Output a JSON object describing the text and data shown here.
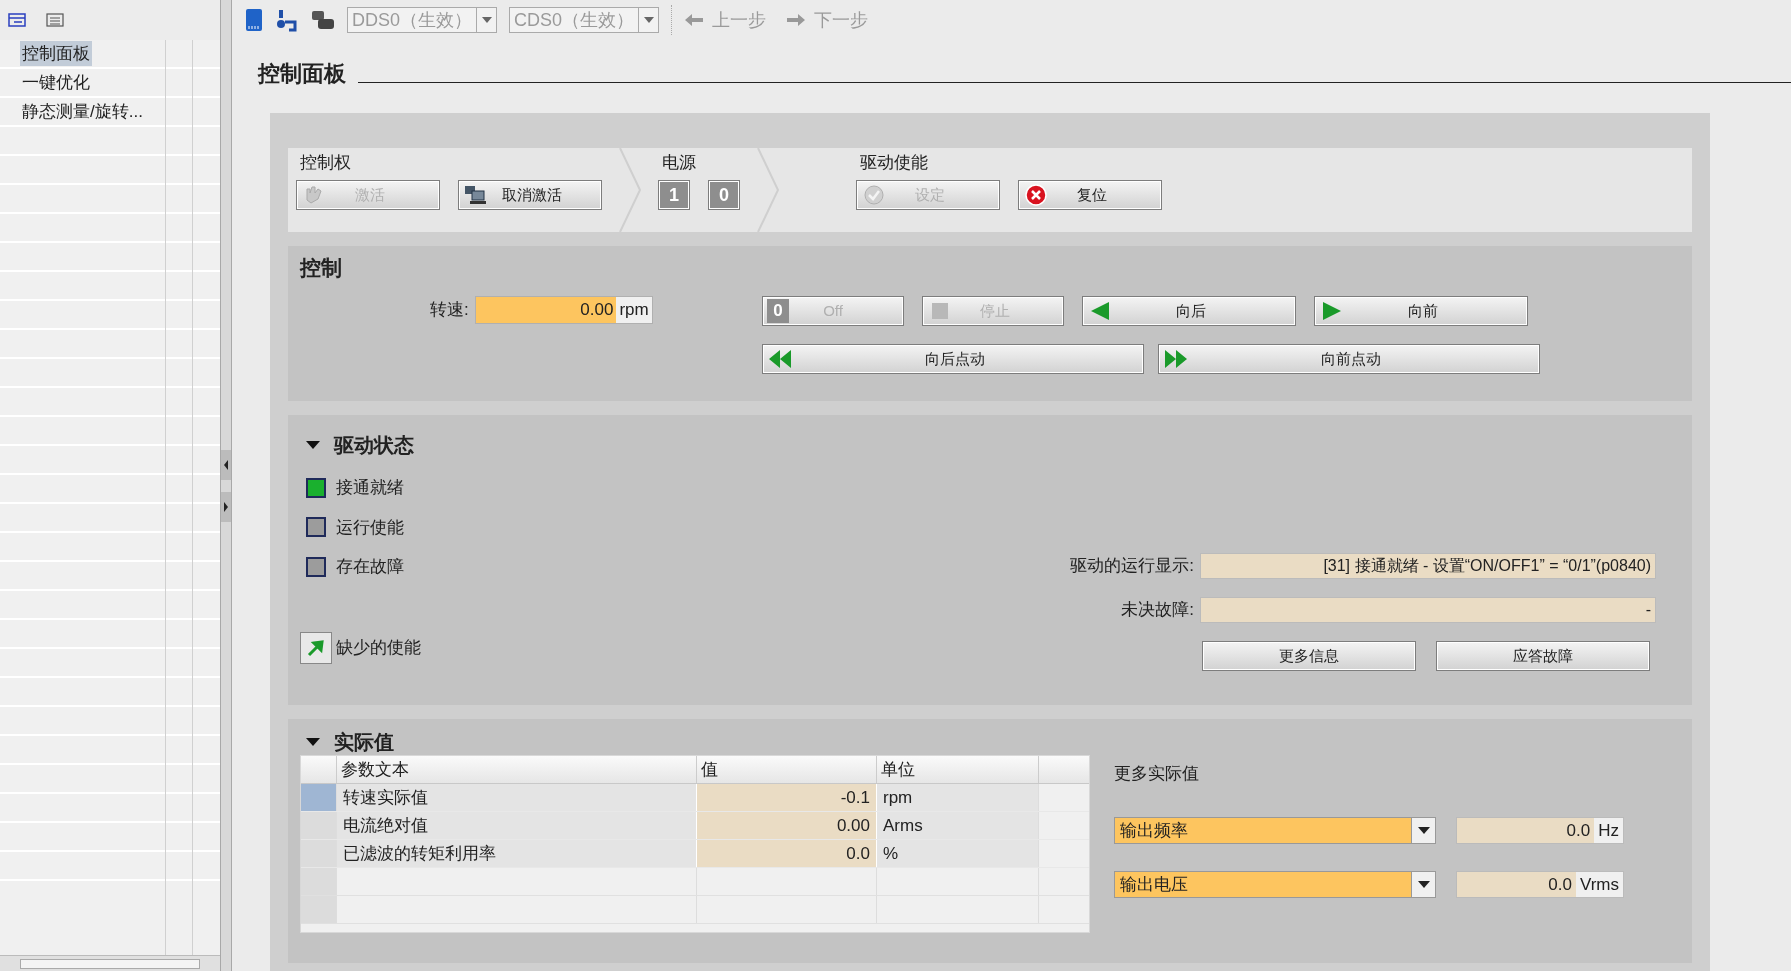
{
  "sidebar": {
    "items": [
      {
        "label": "控制面板",
        "selected": true
      },
      {
        "label": "一键优化",
        "selected": false
      },
      {
        "label": "静态测量/旋转...",
        "selected": false
      }
    ]
  },
  "toolbar": {
    "dds": "DDS0（生效）",
    "cds": "CDS0（生效）",
    "back": "上一步",
    "forward": "下一步"
  },
  "page_title": "控制面板",
  "top_strip": [
    {
      "label": "控制权",
      "buttons": [
        {
          "kind": "hand",
          "label": "激活",
          "disabled": true
        },
        {
          "kind": "pc",
          "label": "取消激活",
          "disabled": false
        }
      ]
    },
    {
      "label": "电源",
      "buttons": [
        {
          "kind": "square",
          "label": "1",
          "disabled": true
        },
        {
          "kind": "square",
          "label": "0",
          "disabled": true
        }
      ]
    },
    {
      "label": "驱动使能",
      "buttons": [
        {
          "kind": "check",
          "label": "设定",
          "disabled": true
        },
        {
          "kind": "error",
          "label": "复位",
          "disabled": false
        }
      ]
    }
  ],
  "control": {
    "title": "控制",
    "speed_label": "转速:",
    "speed_value": "0.00",
    "speed_unit": "rpm",
    "buttons": [
      {
        "kind": "off",
        "icon_text": "0",
        "label": "Off",
        "disabled": true
      },
      {
        "kind": "stop",
        "label": "停止",
        "disabled": true
      },
      {
        "kind": "back",
        "label": "向后",
        "disabled": false
      },
      {
        "kind": "forward",
        "label": "向前",
        "disabled": false
      },
      {
        "kind": "jog_back",
        "label": "向后点动",
        "disabled": false
      },
      {
        "kind": "jog_forward",
        "label": "向前点动",
        "disabled": false
      }
    ]
  },
  "drive_status": {
    "title": "驱动状态",
    "expanded": true,
    "indicators": [
      {
        "label": "接通就绪",
        "on": true
      },
      {
        "label": "运行使能",
        "on": false
      },
      {
        "label": "存在故障",
        "on": false
      }
    ],
    "missing_enable": "缺少的使能",
    "run_display_label": "驱动的运行显示:",
    "run_display_value": "[31] 接通就绪 - 设置“ON/OFF1” = “0/1”(p0840)",
    "open_fault_label": "未决故障:",
    "open_fault_value": "-",
    "buttons": [
      "更多信息",
      "应答故障"
    ]
  },
  "actual_values": {
    "title": "实际值",
    "expanded": true,
    "columns": [
      "参数文本",
      "值",
      "单位"
    ],
    "rows": [
      {
        "name": "转速实际值",
        "value": "-0.1",
        "unit": "rpm",
        "selected": true
      },
      {
        "name": "电流绝对值",
        "value": "0.00",
        "unit": "Arms",
        "selected": false
      },
      {
        "name": "已滤波的转矩利用率",
        "value": "0.0",
        "unit": "%",
        "selected": false
      }
    ],
    "more_title": "更多实际值",
    "more": [
      {
        "select": "输出频率",
        "value": "0.0",
        "unit": "Hz"
      },
      {
        "select": "输出电压",
        "value": "0.0",
        "unit": "Vrms"
      }
    ]
  }
}
